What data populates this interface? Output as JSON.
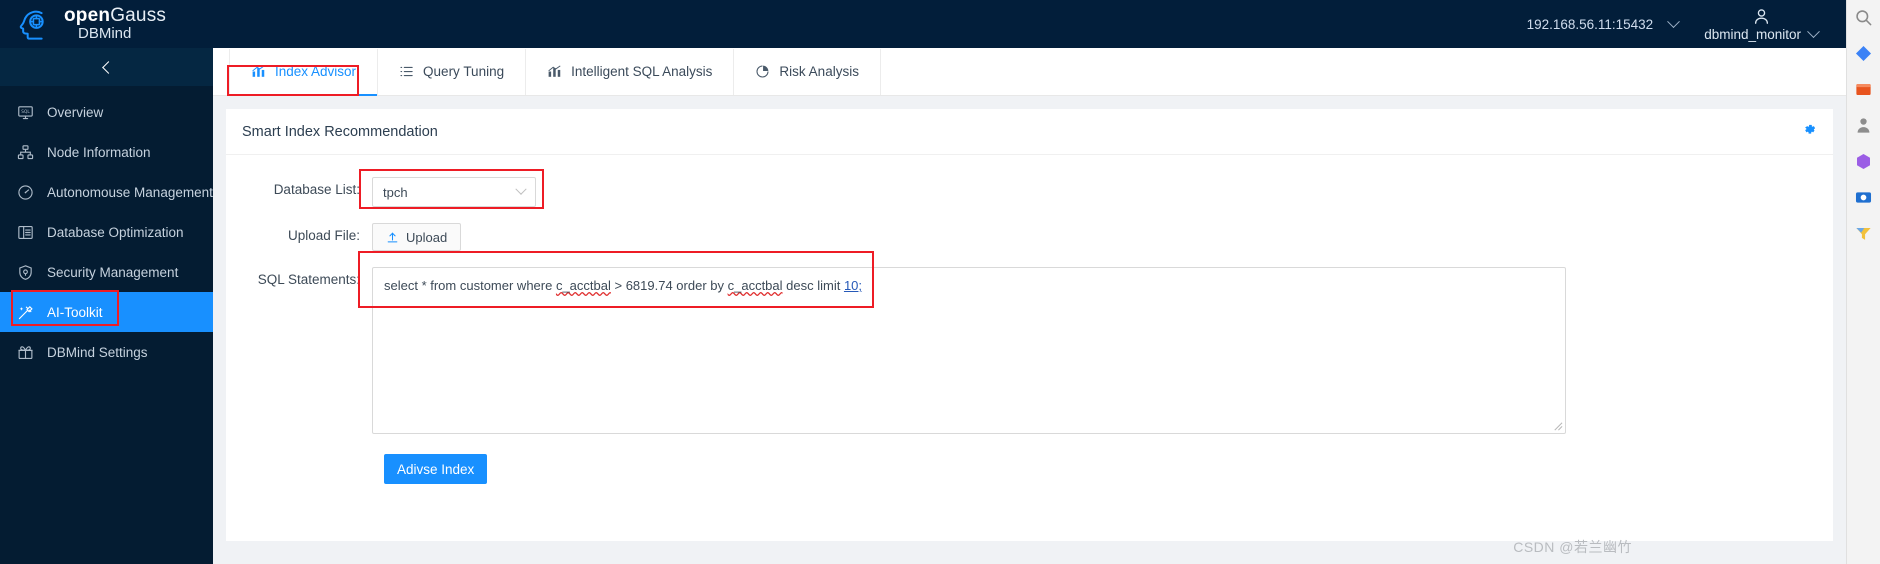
{
  "header": {
    "brand_open": "open",
    "brand_gauss": "Gauss",
    "brand_sub": "DBMind",
    "host": "192.168.56.11:15432",
    "user": "dbmind_monitor",
    "host_caret_icon": "chevron-down-icon",
    "user_icon": "user-avatar-icon",
    "user_caret_icon": "chevron-down-icon"
  },
  "sidebar": {
    "collapse_icon": "chevron-left-icon",
    "items": [
      {
        "label": "Overview",
        "icon": "monitor-sql-icon",
        "active": false
      },
      {
        "label": "Node Information",
        "icon": "sitemap-icon",
        "active": false
      },
      {
        "label": "Autonomouse Management",
        "icon": "gauge-icon",
        "active": false
      },
      {
        "label": "Database Optimization",
        "icon": "list-table-icon",
        "active": false
      },
      {
        "label": "Security Management",
        "icon": "shield-icon",
        "active": false
      },
      {
        "label": "AI-Toolkit",
        "icon": "magic-wand-icon",
        "active": true
      },
      {
        "label": "DBMind Settings",
        "icon": "gift-box-icon",
        "active": false
      }
    ]
  },
  "tabs": [
    {
      "label": "Index Advisor",
      "icon": "bar-chart-icon",
      "active": true
    },
    {
      "label": "Query Tuning",
      "icon": "list-icon",
      "active": false
    },
    {
      "label": "Intelligent SQL Analysis",
      "icon": "bar-chart-icon",
      "active": false
    },
    {
      "label": "Risk Analysis",
      "icon": "pie-chart-icon",
      "active": false
    }
  ],
  "card": {
    "title": "Smart Index Recommendation",
    "settings_icon": "gear-icon"
  },
  "form": {
    "database_label": "Database List:",
    "database_value": "tpch",
    "database_caret_icon": "chevron-down-icon",
    "upload_label": "Upload File:",
    "upload_button": "Upload",
    "upload_icon": "upload-arrow-icon",
    "sql_label": "SQL Statements:",
    "sql_prefix": "select * from customer where ",
    "sql_col1": "c_acctbal",
    "sql_mid": " > 6819.74 order by ",
    "sql_col2": "c_acctbal",
    "sql_suffix": " desc limit ",
    "sql_limit": "10;",
    "submit_button": "Adivse Index"
  },
  "watermark": "CSDN @若兰幽竹",
  "colors": {
    "header_bg": "#021e3a",
    "sidebar_bg": "#041c32",
    "accent": "#1890ff",
    "annotation": "#ee1c25",
    "page_bg": "#f0f2f5"
  }
}
